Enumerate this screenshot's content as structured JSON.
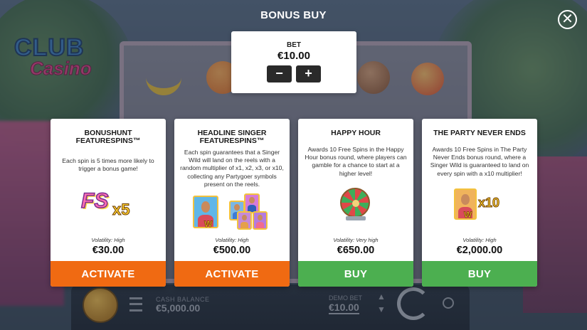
{
  "title": "BONUS BUY",
  "close_icon": "close-icon",
  "bet": {
    "label": "BET",
    "value": "€10.00",
    "minus_label": "−",
    "plus_label": "+"
  },
  "cards": [
    {
      "title": "BONUSHUNT FEATURESPINS™",
      "description": "Each spin is 5 times more likely to trigger a bonus game!",
      "volatility": "Volatility: High",
      "price": "€30.00",
      "action": "ACTIVATE",
      "action_color": "#f06a12",
      "art": {
        "big": "FS",
        "mult": "x5"
      }
    },
    {
      "title": "HEADLINE SINGER FEATURESPINS™",
      "description": "Each spin guarantees that a Singer Wild will land on the reels with a random multiplier of x1, x2, x3, or x10, collecting any Partygoer symbols present on the reels.",
      "volatility": "Volatility: High",
      "price": "€500.00",
      "action": "ACTIVATE",
      "action_color": "#f06a12",
      "art": {
        "wild": "W"
      }
    },
    {
      "title": "HAPPY HOUR",
      "description": "Awards 10 Free Spins in the Happy Hour bonus round, where players can gamble for a chance to start at a higher level!",
      "volatility": "Volatility: Very high",
      "price": "€650.00",
      "action": "BUY",
      "action_color": "#4caf50"
    },
    {
      "title": "THE PARTY NEVER ENDS",
      "description": "Awards 10 Free Spins in The Party Never Ends bonus round, where a Singer Wild is guaranteed to land on every spin with a x10 multiplier!",
      "volatility": "Volatility: High",
      "price": "€2,000.00",
      "action": "BUY",
      "action_color": "#4caf50",
      "art": {
        "wild": "W",
        "mult": "x10"
      }
    }
  ],
  "background": {
    "logo_line1": "CLUB",
    "logo_line2": "Casino",
    "balance_label": "CASH BALANCE",
    "balance_value": "€5,000.00",
    "bet_label": "DEMO BET",
    "bet_value": "€10.00"
  }
}
